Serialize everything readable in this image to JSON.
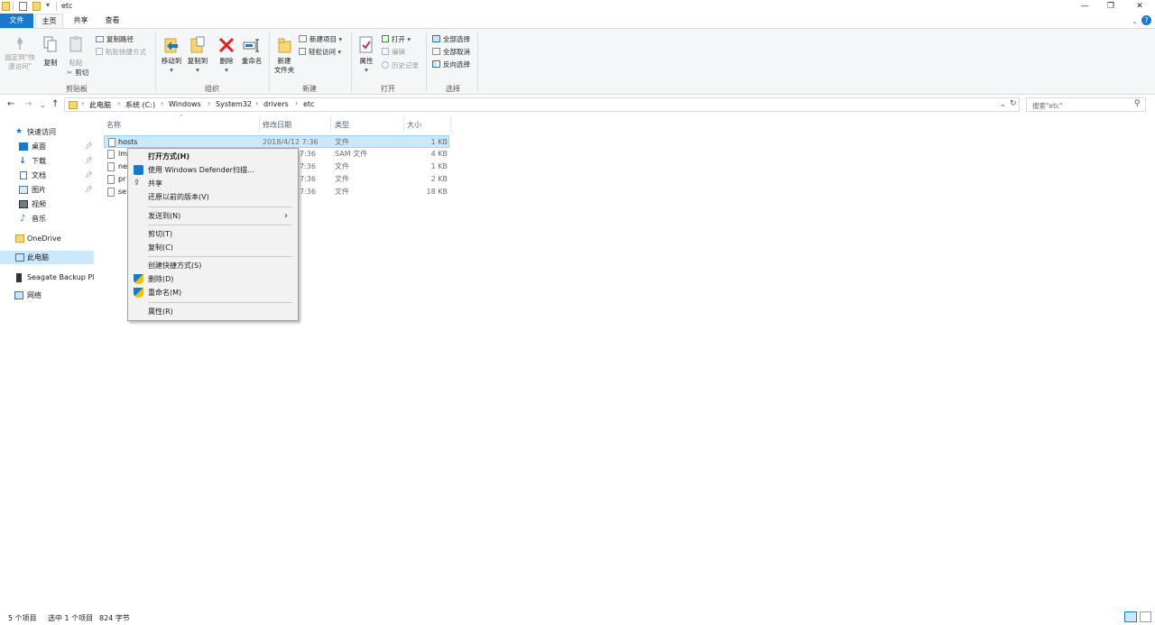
{
  "window": {
    "title": "etc",
    "minimize": "—",
    "maximize": "❐",
    "close": "✕",
    "help": "?"
  },
  "tabs": [
    {
      "label": "文件"
    },
    {
      "label": "主页"
    },
    {
      "label": "共享"
    },
    {
      "label": "查看"
    }
  ],
  "ribbon": {
    "clipboard": {
      "pin_label": "固定到\"快\n速访问\"",
      "copy": "复制",
      "paste": "粘贴",
      "copy_path": "复制路径",
      "paste_shortcut": "粘贴快捷方式",
      "cut": "剪切",
      "group": "剪贴板"
    },
    "organize": {
      "move_to": "移动到",
      "copy_to": "复制到",
      "delete": "删除",
      "rename": "重命名",
      "group": "组织"
    },
    "new": {
      "new_folder": "新建\n文件夹",
      "new_item": "新建项目",
      "easy_access": "轻松访问",
      "group": "新建"
    },
    "open": {
      "properties": "属性",
      "open": "打开",
      "edit": "编辑",
      "history": "历史记录",
      "group": "打开"
    },
    "select": {
      "select_all": "全部选择",
      "select_none": "全部取消",
      "invert": "反向选择",
      "group": "选择"
    }
  },
  "address": {
    "crumbs": [
      "此电脑",
      "系统 (C:)",
      "Windows",
      "System32",
      "drivers",
      "etc"
    ],
    "search_placeholder": "搜索\"etc\""
  },
  "navpane": {
    "items": [
      {
        "label": "快速访问"
      },
      {
        "label": "桌面"
      },
      {
        "label": "下载"
      },
      {
        "label": "文档"
      },
      {
        "label": "图片"
      },
      {
        "label": "视频"
      },
      {
        "label": "音乐"
      },
      {
        "label": "OneDrive"
      },
      {
        "label": "此电脑"
      },
      {
        "label": "Seagate Backup Pl"
      },
      {
        "label": "网络"
      }
    ]
  },
  "columns": {
    "name": "名称",
    "date": "修改日期",
    "type": "类型",
    "size": "大小"
  },
  "files": [
    {
      "name": "hosts",
      "date": "2018/4/12 7:36",
      "type": "文件",
      "size": "1 KB"
    },
    {
      "name": "lm",
      "date": "7:36",
      "type": "SAM 文件",
      "size": "4 KB"
    },
    {
      "name": "ne",
      "date": "7:36",
      "type": "文件",
      "size": "1 KB"
    },
    {
      "name": "pr",
      "date": "7:36",
      "type": "文件",
      "size": "2 KB"
    },
    {
      "name": "se",
      "date": "7:36",
      "type": "文件",
      "size": "18 KB"
    }
  ],
  "context_menu": {
    "open_with": "打开方式(H)",
    "defender": "使用 Windows Defender扫描...",
    "share": "共享",
    "restore": "还原以前的版本(V)",
    "send_to": "发送到(N)",
    "cut": "剪切(T)",
    "copy": "复制(C)",
    "create_shortcut": "创建快捷方式(S)",
    "delete": "删除(D)",
    "rename": "重命名(M)",
    "properties": "属性(R)"
  },
  "status": {
    "count": "5 个项目",
    "selected": "选中 1 个项目",
    "size": "824 字节"
  },
  "colors": {
    "accent": "#1979ca",
    "selection": "#cce8ff",
    "folder": "#f8d775"
  }
}
